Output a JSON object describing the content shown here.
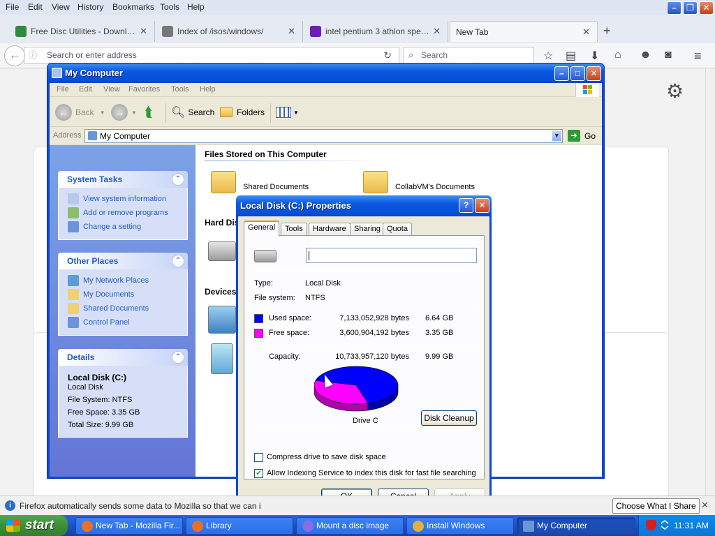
{
  "firefox": {
    "menu": [
      "File",
      "Edit",
      "View",
      "History",
      "Bookmarks",
      "Tools",
      "Help"
    ],
    "window_buttons": [
      "–",
      "❐",
      "✕"
    ],
    "tabs": [
      {
        "label": "Free Disc Utilities - Download ...",
        "color": "#2e8b3f"
      },
      {
        "label": "Index of /isos/windows/",
        "color": "#555555"
      },
      {
        "label": "intel pentium 3 athlon specs - ...",
        "color": "#6a1fb8"
      },
      {
        "label": "New Tab",
        "color": ""
      }
    ],
    "tab_close": "✕",
    "new_tab": "+",
    "url_placeholder": "Search or enter address",
    "search_placeholder": "Search",
    "notification": {
      "text": "Firefox automatically sends some data to Mozilla so that we can i",
      "button": "Choose What I Share"
    }
  },
  "explorer": {
    "title": "My Computer",
    "window_buttons": [
      "–",
      "□",
      "✕"
    ],
    "menu": [
      "File",
      "Edit",
      "View",
      "Favorites",
      "Tools",
      "Help"
    ],
    "toolbar": {
      "back": "Back",
      "search": "Search",
      "folders": "Folders"
    },
    "address": {
      "label": "Address",
      "value": "My Computer",
      "go": "Go"
    },
    "system_tasks": {
      "title": "System Tasks",
      "items": [
        "View system information",
        "Add or remove programs",
        "Change a setting"
      ]
    },
    "other_places": {
      "title": "Other Places",
      "items": [
        "My Network Places",
        "My Documents",
        "Shared Documents",
        "Control Panel"
      ]
    },
    "details": {
      "title": "Details",
      "name": "Local Disk (C:)",
      "type": "Local Disk",
      "fs": "File System: NTFS",
      "free": "Free Space: 3.35 GB",
      "total": "Total Size: 9.99 GB"
    },
    "sections": {
      "files": "Files Stored on This Computer",
      "hard": "Hard Dis",
      "devices": "Devices"
    },
    "folders": [
      "Shared Documents",
      "CollabVM's Documents"
    ]
  },
  "properties": {
    "title": "Local Disk (C:) Properties",
    "tabs": [
      "General",
      "Tools",
      "Hardware",
      "Sharing",
      "Quota"
    ],
    "type_label": "Type:",
    "type_value": "Local Disk",
    "fs_label": "File system:",
    "fs_value": "NTFS",
    "used": {
      "label": "Used space:",
      "bytes": "7,133,052,928 bytes",
      "gb": "6.64 GB",
      "color": "#0000ff"
    },
    "free": {
      "label": "Free space:",
      "bytes": "3,600,904,192 bytes",
      "gb": "3.35 GB",
      "color": "#ff00ff"
    },
    "capacity": {
      "label": "Capacity:",
      "bytes": "10,733,957,120 bytes",
      "gb": "9.99 GB"
    },
    "used_fraction": 0.6645,
    "drive_label": "Drive C",
    "cleanup": "Disk Cleanup",
    "compress": {
      "label": "Compress drive to save disk space",
      "checked": false
    },
    "indexing": {
      "label": "Allow Indexing Service to index this disk for fast file searching",
      "checked": true
    },
    "buttons": {
      "ok": "OK",
      "cancel": "Cancel",
      "apply": "Apply"
    }
  },
  "taskbar": {
    "start": "start",
    "buttons": [
      {
        "label": "New Tab - Mozilla Fir...",
        "color": "#e8702a"
      },
      {
        "label": "Library",
        "color": "#e8702a"
      },
      {
        "label": "Mount a disc image",
        "color": "#8a6de0"
      },
      {
        "label": "Install Windows",
        "color": "#e0b040"
      },
      {
        "label": "My Computer",
        "color": "#6a95d8"
      }
    ],
    "clock": "11:31 AM"
  }
}
